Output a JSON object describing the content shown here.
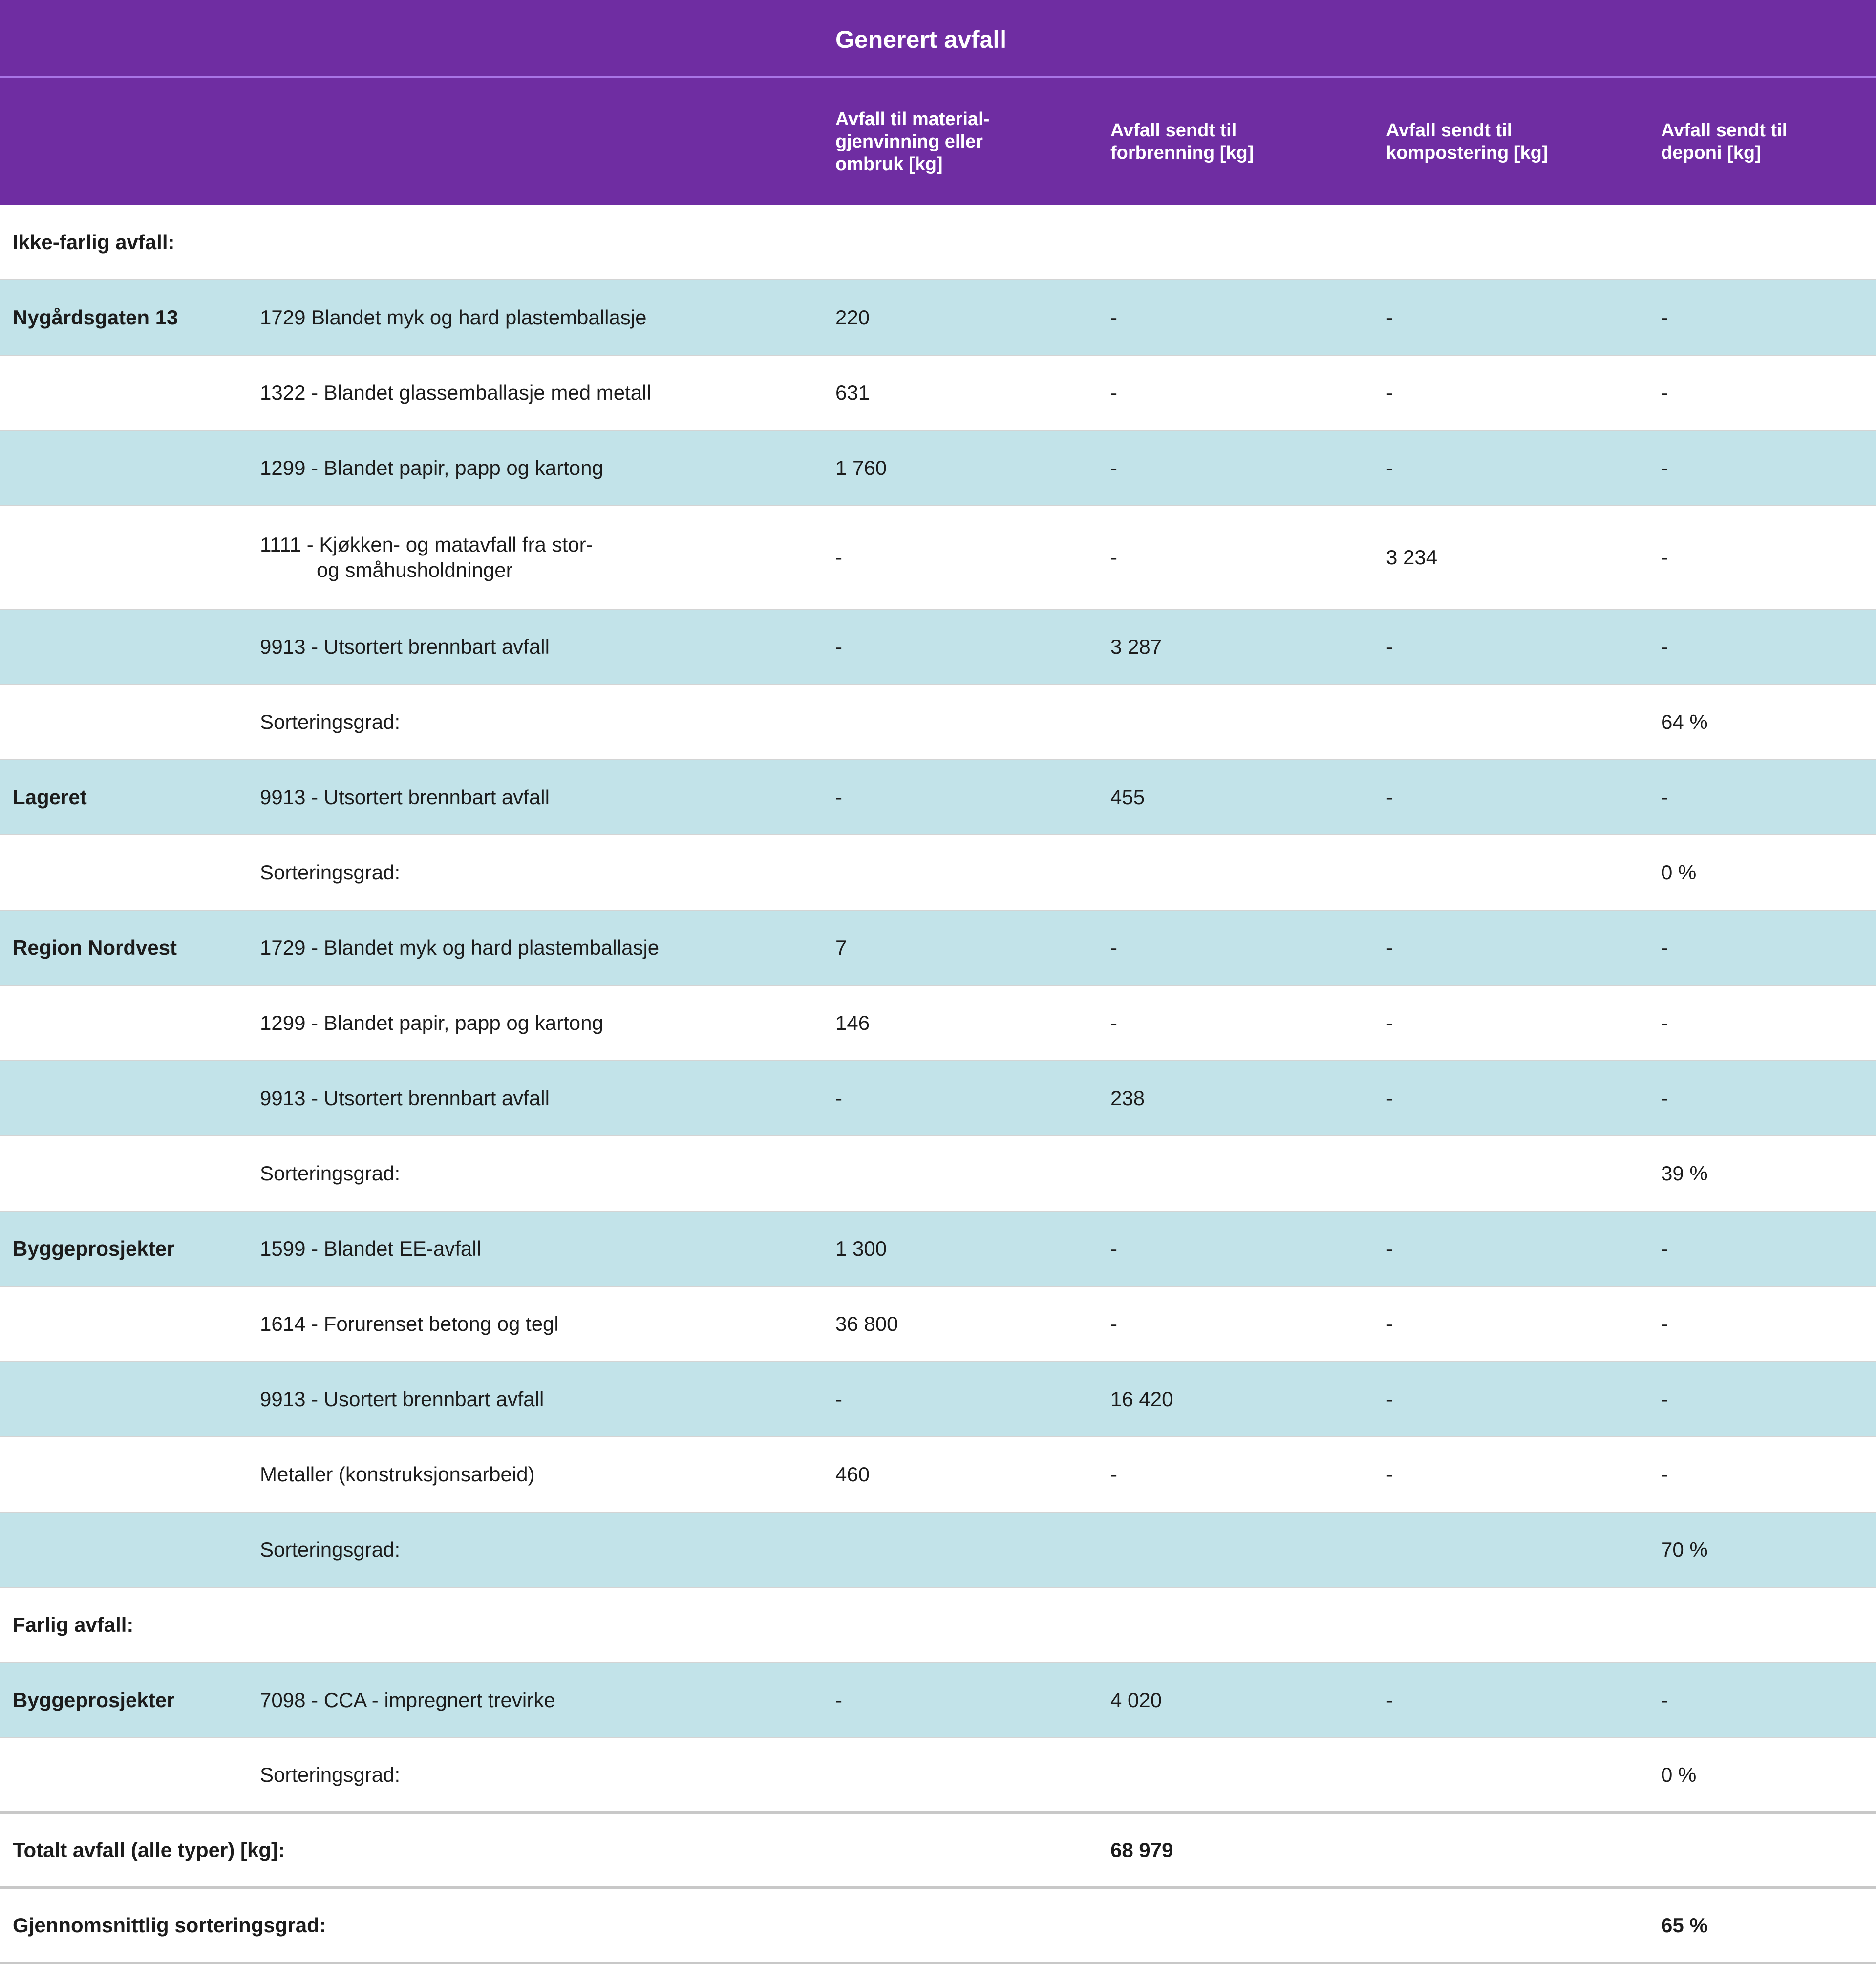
{
  "title": "Generert avfall",
  "columns": {
    "recycling": "Avfall til material-\ngjenvinning eller\nombruk [kg]",
    "incineration": "Avfall sendt til\nforbrenning [kg]",
    "composting": "Avfall sendt til\nkompostering [kg]",
    "landfill": "Avfall sendt til\ndeponi [kg]"
  },
  "sections": {
    "non_hazardous": "Ikke-farlig avfall:",
    "hazardous": "Farlig avfall:"
  },
  "rows": [
    {
      "location": "Nygårdsgaten 13",
      "type": "1729 Blandet myk og hard plastemballasje",
      "recycling": "220",
      "incineration": "-",
      "composting": "-",
      "landfill": "-"
    },
    {
      "location": "",
      "type": "1322 - Blandet glassemballasje med metall",
      "recycling": "631",
      "incineration": "-",
      "composting": "-",
      "landfill": "-"
    },
    {
      "location": "",
      "type": "1299 - Blandet papir, papp og kartong",
      "recycling": "1 760",
      "incineration": "-",
      "composting": "-",
      "landfill": "-"
    },
    {
      "location": "",
      "type_line1": "1111 - Kjøkken- og matavfall fra stor-",
      "type_line2": "og småhusholdninger",
      "recycling": "-",
      "incineration": "-",
      "composting": "3 234",
      "landfill": "-"
    },
    {
      "location": "",
      "type": "9913 - Utsortert brennbart avfall",
      "recycling": "-",
      "incineration": "3 287",
      "composting": "-",
      "landfill": "-"
    },
    {
      "location": "",
      "type": "Sorteringsgrad:",
      "landfill": "64 %"
    },
    {
      "location": "Lageret",
      "type": "9913 - Utsortert brennbart avfall",
      "recycling": "-",
      "incineration": "455",
      "composting": "-",
      "landfill": "-"
    },
    {
      "location": "",
      "type": "Sorteringsgrad:",
      "landfill": "0 %"
    },
    {
      "location": "Region Nordvest",
      "type": "1729 - Blandet myk og hard plastemballasje",
      "recycling": "7",
      "incineration": "-",
      "composting": "-",
      "landfill": "-"
    },
    {
      "location": "",
      "type": "1299 - Blandet papir, papp og kartong",
      "recycling": "146",
      "incineration": "-",
      "composting": "-",
      "landfill": "-"
    },
    {
      "location": "",
      "type": "9913 - Utsortert brennbart avfall",
      "recycling": "-",
      "incineration": "238",
      "composting": "-",
      "landfill": "-"
    },
    {
      "location": "",
      "type": "Sorteringsgrad:",
      "landfill": "39 %"
    },
    {
      "location": "Byggeprosjekter",
      "type": "1599 - Blandet EE-avfall",
      "recycling": "1 300",
      "incineration": "-",
      "composting": "-",
      "landfill": "-"
    },
    {
      "location": "",
      "type": "1614 - Forurenset betong og tegl",
      "recycling": "36 800",
      "incineration": "-",
      "composting": "-",
      "landfill": "-"
    },
    {
      "location": "",
      "type": "9913 - Usortert brennbart avfall",
      "recycling": "-",
      "incineration": "16 420",
      "composting": "-",
      "landfill": "-"
    },
    {
      "location": "",
      "type": "Metaller (konstruksjonsarbeid)",
      "recycling": "460",
      "incineration": "-",
      "composting": "-",
      "landfill": "-"
    },
    {
      "location": "",
      "type": "Sorteringsgrad:",
      "landfill": "70 %"
    },
    {
      "location": "Byggeprosjekter",
      "type": "7098 - CCA - impregnert trevirke",
      "recycling": "-",
      "incineration": "4 020",
      "composting": "-",
      "landfill": "-"
    },
    {
      "location": "",
      "type": "Sorteringsgrad:",
      "landfill": "0 %"
    }
  ],
  "totals": {
    "total_label": "Totalt avfall (alle typer) [kg]:",
    "total_value": "68 979",
    "avg_label": "Gjennomsnittlig sorteringsgrad:",
    "avg_value": "65 %"
  }
}
